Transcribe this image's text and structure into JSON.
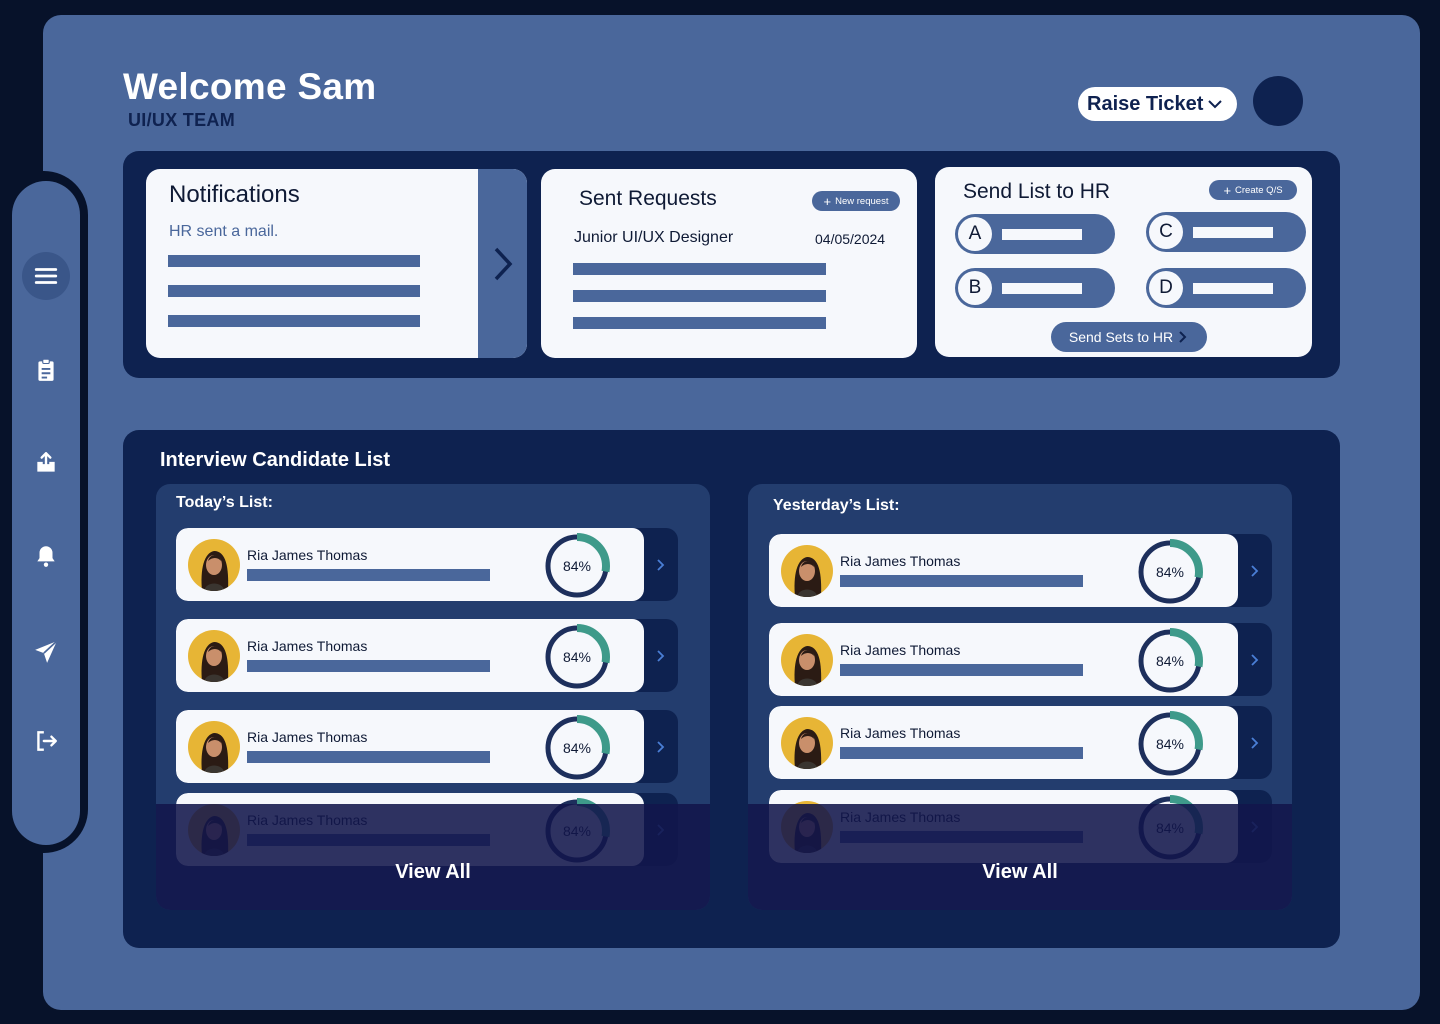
{
  "header": {
    "welcome": "Welcome Sam",
    "team": "UI/UX TEAM",
    "raise_ticket": "Raise Ticket"
  },
  "sidebar": {
    "items": [
      {
        "icon": "menu-icon",
        "active": true
      },
      {
        "icon": "clipboard-icon",
        "active": false
      },
      {
        "icon": "upload-icon",
        "active": false
      },
      {
        "icon": "bell-icon",
        "active": false
      },
      {
        "icon": "send-icon",
        "active": false
      },
      {
        "icon": "logout-icon",
        "active": false
      }
    ]
  },
  "notifications": {
    "title": "Notifications",
    "message": "HR sent a mail."
  },
  "sent_requests": {
    "title": "Sent Requests",
    "new_request": "New request",
    "role": "Junior UI/UX Designer",
    "date": "04/05/2024"
  },
  "send_list": {
    "title": "Send List to HR",
    "create": "Create Q/S",
    "sets": [
      "A",
      "C",
      "B",
      "D"
    ],
    "send_button": "Send Sets to HR"
  },
  "candidates": {
    "title": "Interview Candidate List",
    "today": {
      "label": "Today’s List:",
      "rows": [
        {
          "name": "Ria James Thomas",
          "score": "84%",
          "score_value": 0.84
        },
        {
          "name": "Ria James Thomas",
          "score": "84%",
          "score_value": 0.84
        },
        {
          "name": "Ria James Thomas",
          "score": "84%",
          "score_value": 0.84
        },
        {
          "name": "Ria James Thomas",
          "score": "84%",
          "score_value": 0.84
        }
      ],
      "view_all": "View All"
    },
    "yesterday": {
      "label": "Yesterday’s List:",
      "rows": [
        {
          "name": "Ria James Thomas",
          "score": "84%",
          "score_value": 0.84
        },
        {
          "name": "Ria James Thomas",
          "score": "84%",
          "score_value": 0.84
        },
        {
          "name": "Ria James Thomas",
          "score": "84%",
          "score_value": 0.84
        },
        {
          "name": "Ria James Thomas",
          "score": "84%",
          "score_value": 0.84
        }
      ],
      "view_all": "View All"
    }
  },
  "colors": {
    "background": "#07122a",
    "app": "#4a679b",
    "panel": "#0e2250",
    "card": "#f6f8fc",
    "accent_teal": "#3e9a8a",
    "avatar_bg": "#e7b535"
  }
}
